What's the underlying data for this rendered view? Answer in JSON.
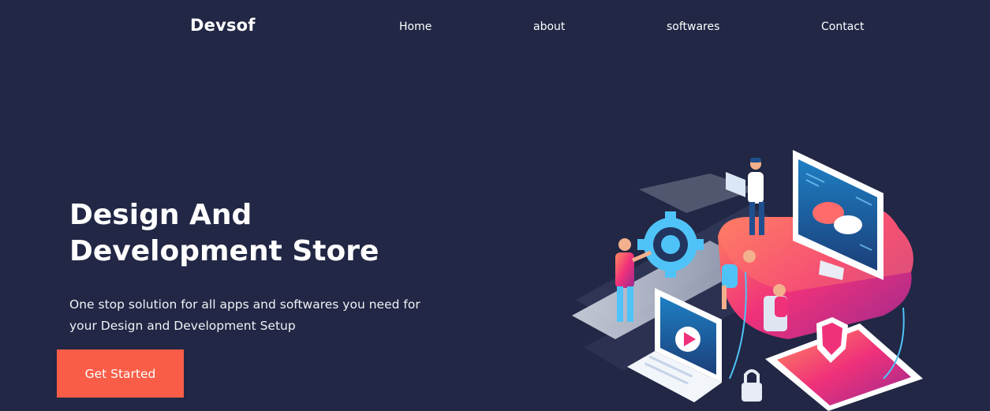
{
  "brand": {
    "name": "Devsof"
  },
  "nav": {
    "items": [
      {
        "label": "Home"
      },
      {
        "label": "about"
      },
      {
        "label": "softwares"
      },
      {
        "label": "Contact"
      }
    ]
  },
  "hero": {
    "title_line1": "Design And",
    "title_line2": "Development Store",
    "description": "One stop solution for all apps and softwares you need for your Design and Development Setup",
    "cta_label": "Get Started"
  },
  "colors": {
    "background": "#212744",
    "accent": "#fa5d47",
    "text": "#ffffff"
  },
  "icons": {
    "hero_illustration": "isometric-dev-illustration"
  }
}
